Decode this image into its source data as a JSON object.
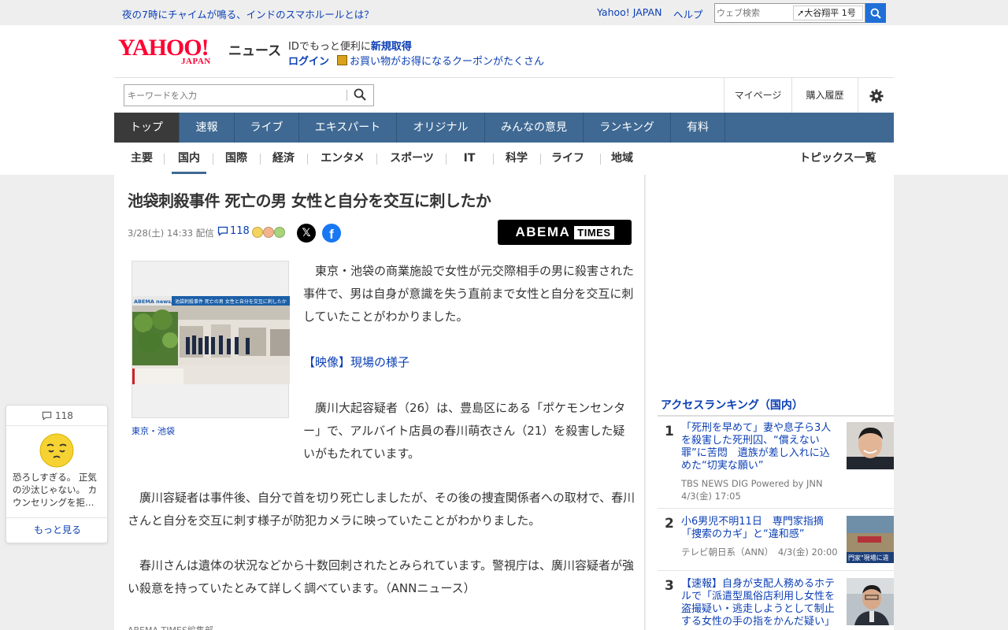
{
  "topbar": {
    "headline": "夜の7時にチャイムが鳴る、インドのスマホルールとは？",
    "yahoo_japan": "Yahoo! JAPAN",
    "help": "ヘルプ",
    "web_search_placeholder": "ウェブ検索",
    "trend": "大谷翔平 1号"
  },
  "header": {
    "logo_main": "YAHOO!",
    "logo_sub": "JAPAN",
    "logo_news": "ニュース",
    "id_prefix": "IDでもっと便利に",
    "signup": "新規取得",
    "login": "ログイン",
    "coupon": "お買い物がお得になるクーポンがたくさん",
    "keyword_placeholder": "キーワードを入力",
    "mypage": "マイページ",
    "history": "購入履歴"
  },
  "gnav": [
    "トップ",
    "速報",
    "ライブ",
    "エキスパート",
    "オリジナル",
    "みんなの意見",
    "ランキング",
    "有料"
  ],
  "subnav": {
    "items": [
      "主要",
      "国内",
      "国際",
      "経済",
      "エンタメ",
      "スポーツ",
      "IT",
      "科学",
      "ライフ",
      "地域"
    ],
    "topics_all": "トピックス一覧"
  },
  "article": {
    "title": "池袋刺殺事件 死亡の男 女性と自分を交互に刺したか",
    "meta": "3/28(土) 14:33 配信",
    "comment_count": "118",
    "provider_logo": "ABEMA",
    "provider_logo_sub": "TIMES",
    "photo_caption": "東京・池袋",
    "photo_banner": "ABEMA news/ 池袋刺殺事件 死亡の男 女性と自分を交互に刺したか",
    "p1": "　東京・池袋の商業施設で女性が元交際相手の男に殺害された事件で、男は自身が意識を失う直前まで女性と自分を交互に刺していたことがわかりました。",
    "video_link": "【映像】現場の様子",
    "p2": "　廣川大起容疑者（26）は、豊島区にある「ポケモンセンター」で、アルバイト店員の春川萌衣さん（21）を殺害した疑いがもたれています。",
    "p3": "　廣川容疑者は事件後、自分で首を切り死亡しましたが、その後の捜査関係者への取材で、春川さんと自分を交互に刺す様子が防犯カメラに映っていたことがわかりました。",
    "p4": "　春川さんは遺体の状況などから十数回刺されたとみられています。警視庁は、廣川容疑者が強い殺意を持っていたとみて詳しく調べています。（ANNニュース）",
    "byline": "ABEMA TIMES編集部"
  },
  "ranking": {
    "title": "アクセスランキング（国内）",
    "items": [
      {
        "rank": "1",
        "text": "「死刑を早めて」妻や息子ら3人を殺害した死刑囚、“償えない罪”に苦悶　遺族が差し入れに込めた“切実な願い”",
        "source": "TBS NEWS DIG Powered by JNN",
        "date": "4/3(金) 17:05"
      },
      {
        "rank": "2",
        "text": "小6男児不明11日　専門家指摘「捜索のカギ」と“違和感”",
        "source": "テレビ朝日系（ANN）",
        "date": "4/3(金) 20:00"
      },
      {
        "rank": "3",
        "text": "【速報】自身が支配人務めるホテルで「派遣型風俗店利用し女性を盗撮疑い・逃走しようとして制止する女性の手の指をかんだ疑い」",
        "source": "",
        "date": ""
      }
    ]
  },
  "float_card": {
    "count": "118",
    "text": "恐ろしすぎる。 正気の沙汰じゃない。 カウンセリングを拒…",
    "more": "もっと見る"
  },
  "colors": {
    "link": "#0b3fb5",
    "nav_bg": "#3f6993",
    "nav_active": "#3a3a3a",
    "logo_red": "#ff0033"
  }
}
